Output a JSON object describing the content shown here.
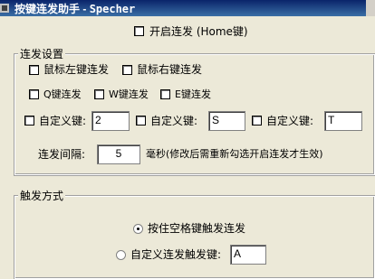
{
  "window": {
    "title_prefix": "按键连发助手",
    "title_sep": " - ",
    "title_app": "Specher"
  },
  "main": {
    "enable_label": "开启连发 (Home键)",
    "settings_group_title": "连发设置",
    "mouse_left_label": "鼠标左键连发",
    "mouse_right_label": "鼠标右键连发",
    "q_label": "Q键连发",
    "w_label": "W键连发",
    "e_label": "E键连发",
    "custom_label": "自定义键:",
    "custom_values": [
      "2",
      "S",
      "T"
    ],
    "interval_label": "连发间隔:",
    "interval_value": "5",
    "interval_note": "毫秒(修改后需重新勾选开启连发才生效)",
    "trigger_group_title": "触发方式",
    "trigger_space_label": "按住空格键触发连发",
    "trigger_custom_label": "自定义连发触发键:",
    "trigger_custom_value": "A"
  },
  "icons": {
    "window": "app-icon"
  }
}
